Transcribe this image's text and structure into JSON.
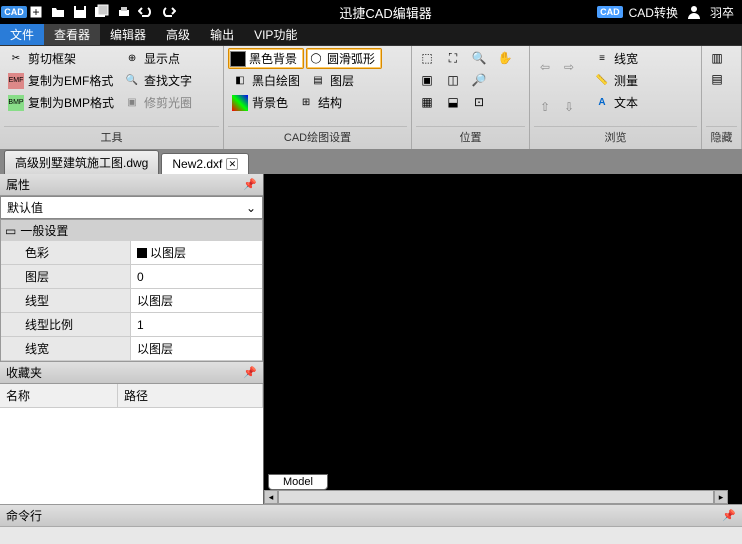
{
  "title": "迅捷CAD编辑器",
  "titlebar_right": {
    "badge": "CAD",
    "convert": "CAD转换",
    "user": "羽卒"
  },
  "menu": {
    "file": "文件",
    "viewer": "查看器",
    "editor": "编辑器",
    "advanced": "高级",
    "output": "输出",
    "vip": "VIP功能"
  },
  "ribbon": {
    "group_tools": {
      "label": "工具",
      "clip_frame": "剪切框架",
      "copy_emf": "复制为EMF格式",
      "copy_bmp": "复制为BMP格式",
      "show_point": "显示点",
      "find_text": "查找文字",
      "trim_aperture": "修剪光圈"
    },
    "group_cad": {
      "label": "CAD绘图设置",
      "black_bg": "黑色背景",
      "smooth_arc": "圆滑弧形",
      "bw_draw": "黑白绘图",
      "layer": "图层",
      "bg_color": "背景色",
      "structure": "结构"
    },
    "group_pos": {
      "label": "位置"
    },
    "group_browse": {
      "label": "浏览",
      "linewidth": "线宽",
      "measure": "测量",
      "text": "文本"
    },
    "group_hide": {
      "label": "隐藏"
    }
  },
  "doctabs": {
    "tab1": "高级别墅建筑施工图.dwg",
    "tab2": "New2.dxf"
  },
  "props": {
    "title": "属性",
    "default": "默认值",
    "section": "一般设置",
    "rows": {
      "color": {
        "k": "色彩",
        "v": "以图层"
      },
      "layer": {
        "k": "图层",
        "v": "0"
      },
      "linetype": {
        "k": "线型",
        "v": "以图层"
      },
      "linescale": {
        "k": "线型比例",
        "v": "1"
      },
      "linewidth": {
        "k": "线宽",
        "v": "以图层"
      }
    }
  },
  "fav": {
    "title": "收藏夹",
    "col_name": "名称",
    "col_path": "路径"
  },
  "model_tab": "Model",
  "cmd": {
    "title": "命令行"
  }
}
